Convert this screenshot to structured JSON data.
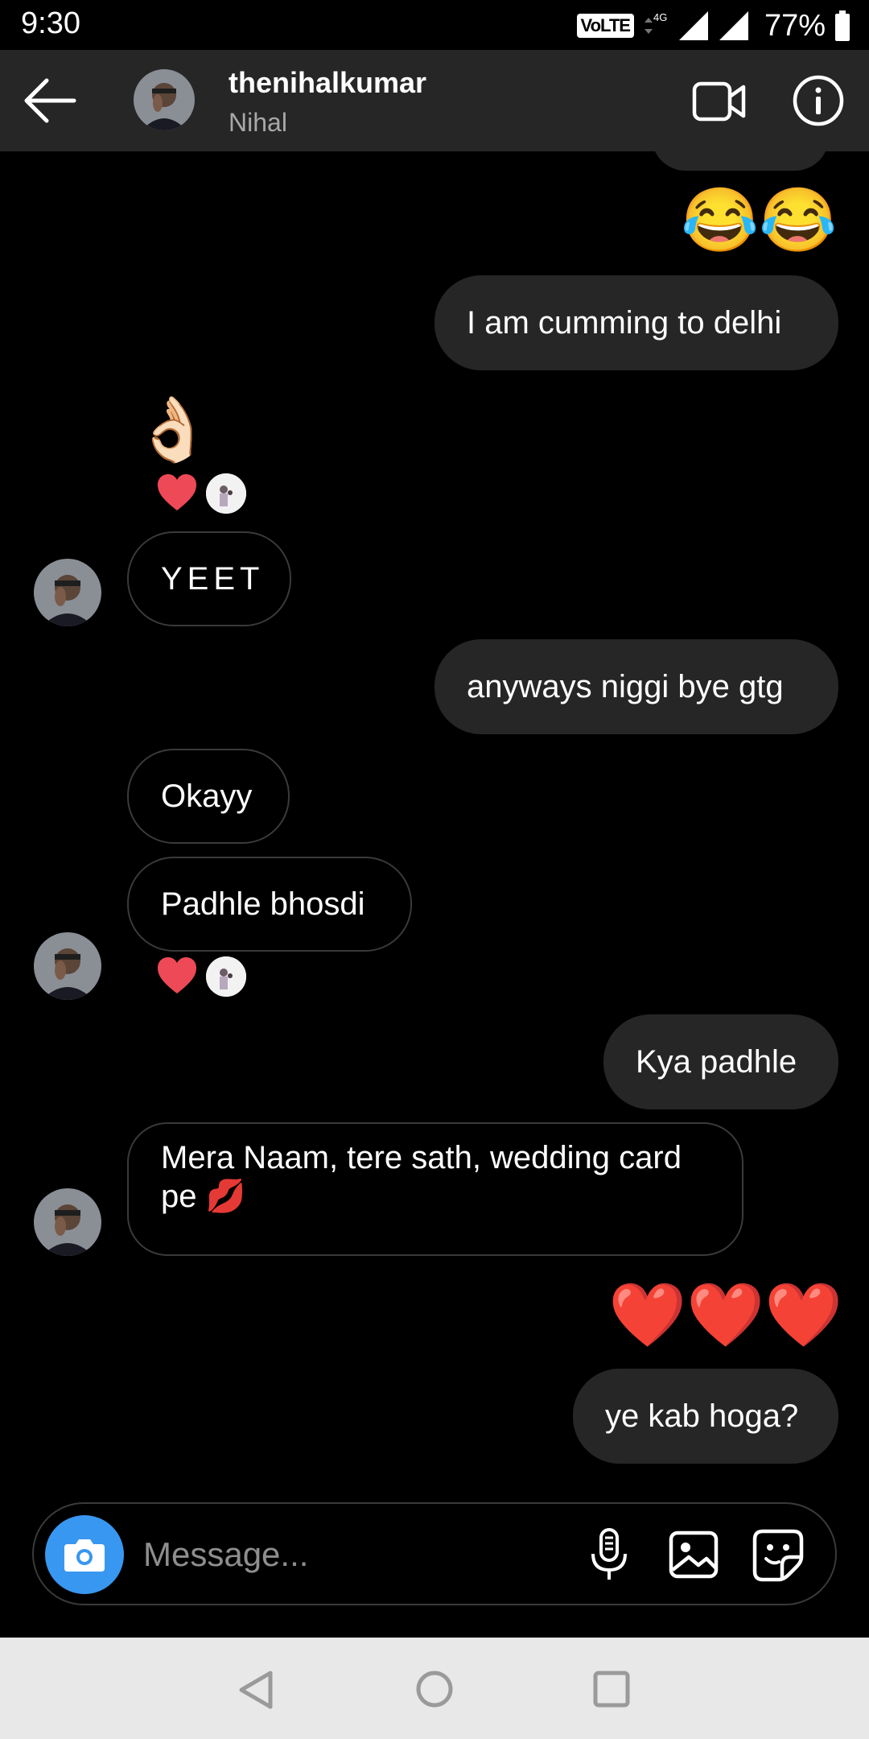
{
  "status_bar": {
    "time": "9:30",
    "volte": "VoLTE",
    "network": "4G",
    "battery": "77%"
  },
  "header": {
    "username": "thenihalkumar",
    "name": "Nihal"
  },
  "messages": {
    "m1_emoji": "😂😂",
    "m2": "I am cumming to delhi",
    "m3_emoji": "👌🏻",
    "m4": "YEET",
    "m5": "anyways niggi bye gtg",
    "m6": "Okayy",
    "m7": "Padhle bhosdi",
    "m8": "Kya padhle",
    "m9": "Mera Naam, tere sath, wedding card pe 💋",
    "m10_emoji": "❤️❤️❤️",
    "m11": "ye kab hoga?"
  },
  "composer": {
    "placeholder": "Message..."
  },
  "colors": {
    "header_bg": "#262626",
    "outgoing_bubble": "#262626",
    "camera_button": "#3897f0",
    "heart": "#ed4956"
  },
  "icons": [
    "back-arrow-icon",
    "video-call-icon",
    "info-icon",
    "camera-icon",
    "microphone-icon",
    "gallery-icon",
    "sticker-icon",
    "heart-icon",
    "nav-back-icon",
    "nav-home-icon",
    "nav-recent-icon"
  ]
}
